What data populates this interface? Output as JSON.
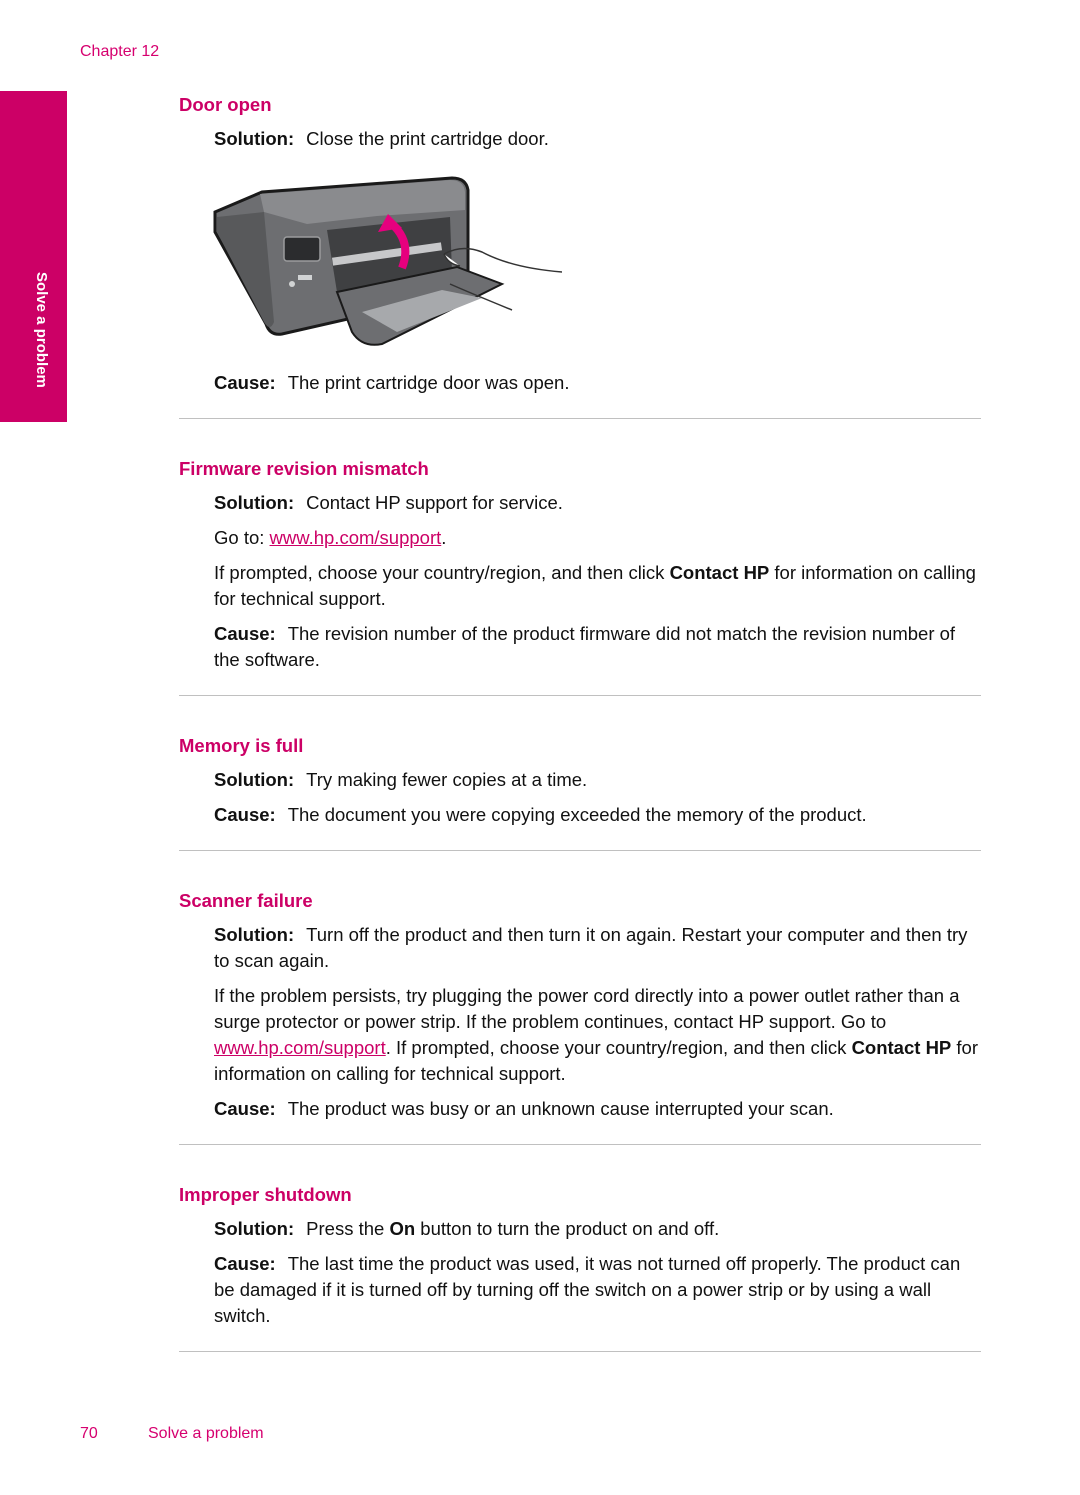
{
  "header": {
    "chapter": "Chapter 12"
  },
  "side_tab": {
    "label": "Solve a problem"
  },
  "colors": {
    "accent": "#cc0066",
    "divider": "#c0c0c0"
  },
  "sections": [
    {
      "title": "Door open",
      "solution_label": "Solution:",
      "solution": "Close the print cartridge door.",
      "figure": {
        "description": "Printer illustration with hand closing print cartridge door, magenta arrow",
        "icon": "printer-door-illustration"
      },
      "cause_label": "Cause:",
      "cause": "The print cartridge door was open."
    },
    {
      "title": "Firmware revision mismatch",
      "solution_label": "Solution:",
      "solution": "Contact HP support for service.",
      "goto_prefix": "Go to: ",
      "goto_link": "www.hp.com/support",
      "goto_suffix": ".",
      "prompt_prefix": "If prompted, choose your country/region, and then click ",
      "prompt_bold": "Contact HP",
      "prompt_suffix": " for information on calling for technical support.",
      "cause_label": "Cause:",
      "cause": "The revision number of the product firmware did not match the revision number of the software."
    },
    {
      "title": "Memory is full",
      "solution_label": "Solution:",
      "solution": "Try making fewer copies at a time.",
      "cause_label": "Cause:",
      "cause": "The document you were copying exceeded the memory of the product."
    },
    {
      "title": "Scanner failure",
      "solution_label": "Solution:",
      "solution": "Turn off the product and then turn it on again. Restart your computer and then try to scan again.",
      "persist_text": "If the problem persists, try plugging the power cord directly into a power outlet rather than a surge protector or power strip. If the problem continues, contact HP support. Go to ",
      "persist_link": "www.hp.com/support",
      "persist_mid": ". If prompted, choose your country/region, and then click ",
      "persist_bold": "Contact HP",
      "persist_suffix": " for information on calling for technical support.",
      "cause_label": "Cause:",
      "cause": "The product was busy or an unknown cause interrupted your scan."
    },
    {
      "title": "Improper shutdown",
      "solution_label": "Solution:",
      "solution_prefix": "Press the ",
      "solution_bold": "On",
      "solution_suffix": " button to turn the product on and off.",
      "cause_label": "Cause:",
      "cause": "The last time the product was used, it was not turned off properly. The product can be damaged if it is turned off by turning off the switch on a power strip or by using a wall switch."
    }
  ],
  "footer": {
    "page_number": "70",
    "title": "Solve a problem"
  }
}
